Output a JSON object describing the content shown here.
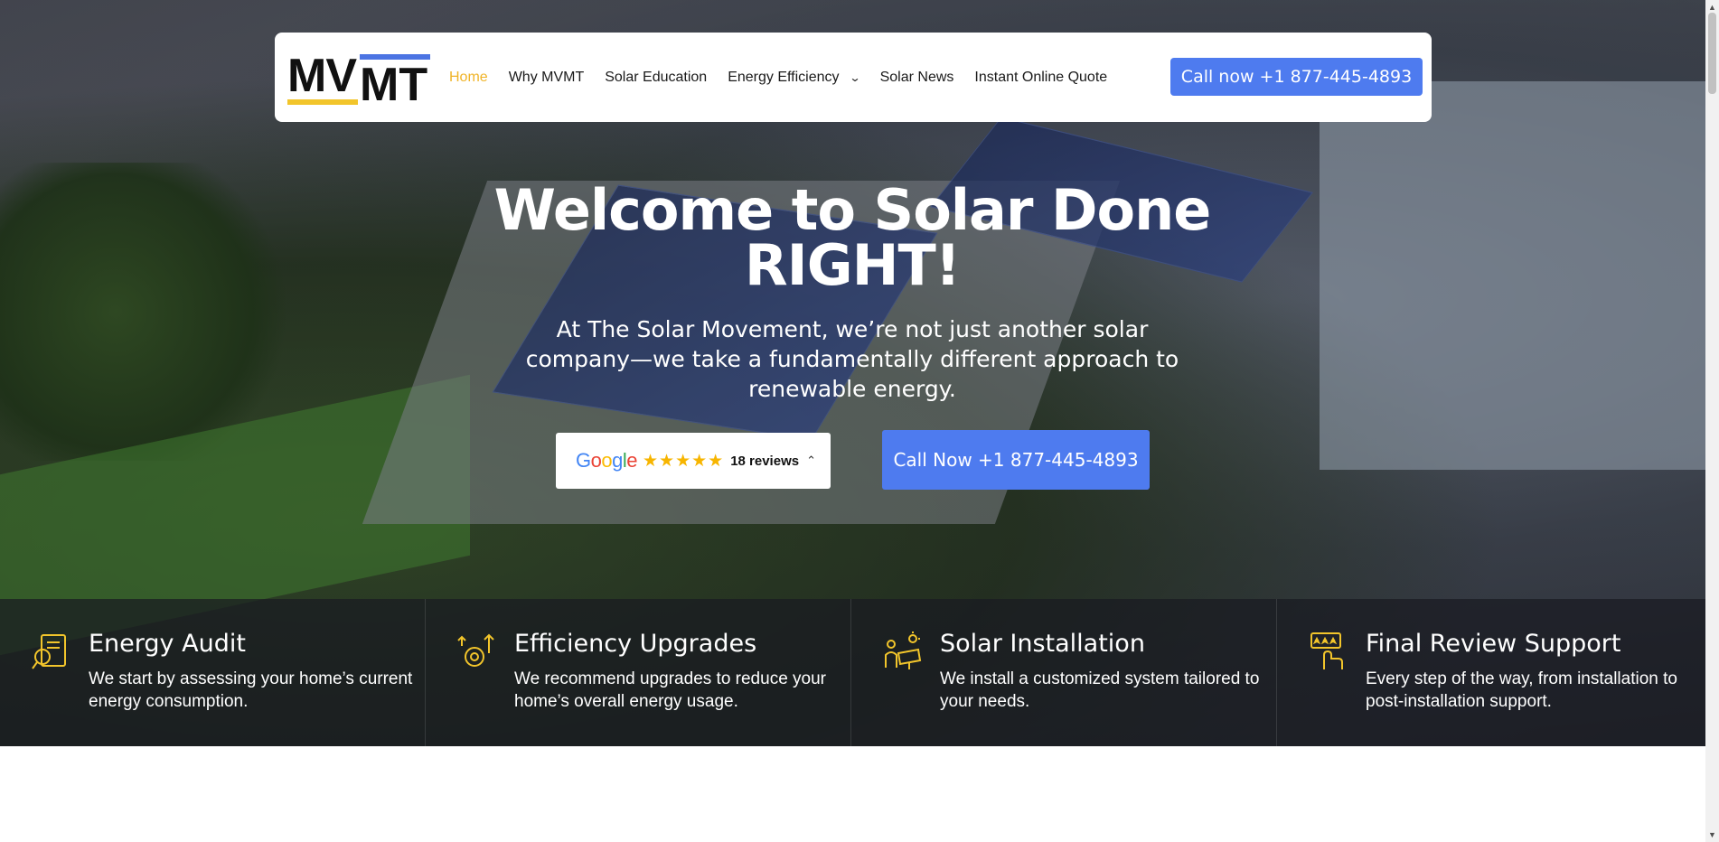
{
  "nav": {
    "logo_text_top": "MV",
    "logo_text_bottom": "MT",
    "links": [
      "Home",
      "Why MVMT",
      "Solar Education",
      "Energy Efficiency",
      "Solar News",
      "Instant Online Quote"
    ],
    "cta": "Call now +1 877-445-4893"
  },
  "hero": {
    "title": "Welcome to Solar Done RIGHT!",
    "subtitle": "At The Solar Movement, we’re not just another solar company—we take a fundamentally different approach to renewable energy.",
    "review": {
      "brand": "Google",
      "stars": "★★★★★",
      "count": "18 reviews"
    },
    "cta": "Call Now +1 877-445-4893"
  },
  "features": [
    {
      "icon": "energy-audit-icon",
      "title": "Energy Audit",
      "text": "We start by assessing your home’s current energy consumption."
    },
    {
      "icon": "efficiency-upgrades-icon",
      "title": "Efficiency Upgrades",
      "text": "We recommend upgrades to reduce your home’s overall energy usage."
    },
    {
      "icon": "solar-installation-icon",
      "title": "Solar Installation",
      "text": "We install a customized system tailored to your needs."
    },
    {
      "icon": "final-review-icon",
      "title": "Final Review Support",
      "text": "Every step of the way, from installation to post-installation support."
    }
  ],
  "colors": {
    "accent": "#4e7bef",
    "active_link": "#f0b429",
    "icon_gold": "#f2c52b"
  }
}
